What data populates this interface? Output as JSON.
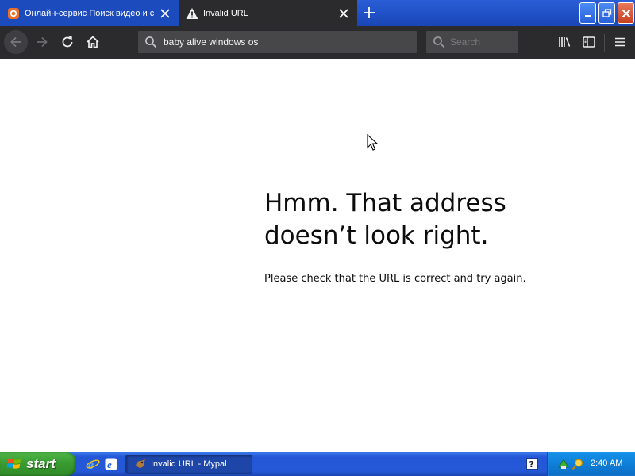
{
  "browser": {
    "tabs": [
      {
        "title": "Онлайн-сервис Поиск видео и с",
        "icon": "video-service-favicon",
        "active": false
      },
      {
        "title": "Invalid URL",
        "icon": "warning-icon",
        "active": true
      }
    ],
    "url": "baby alive windows os",
    "search_placeholder": "Search"
  },
  "error_page": {
    "title_line1": "Hmm. That address",
    "title_line2": "doesn’t look right.",
    "message": "Please check that the URL is correct and try again."
  },
  "taskbar": {
    "start_label": "start",
    "task_item_label": "Invalid URL - Mypal",
    "clock": "2:40 AM"
  },
  "colors": {
    "tab_strip": "#1f4fc4",
    "toolbar": "#2b2b2e",
    "urlbar": "#474749",
    "taskbar": "#2458d7",
    "start_button": "#3a9b31",
    "tray": "#0f7fd8"
  }
}
